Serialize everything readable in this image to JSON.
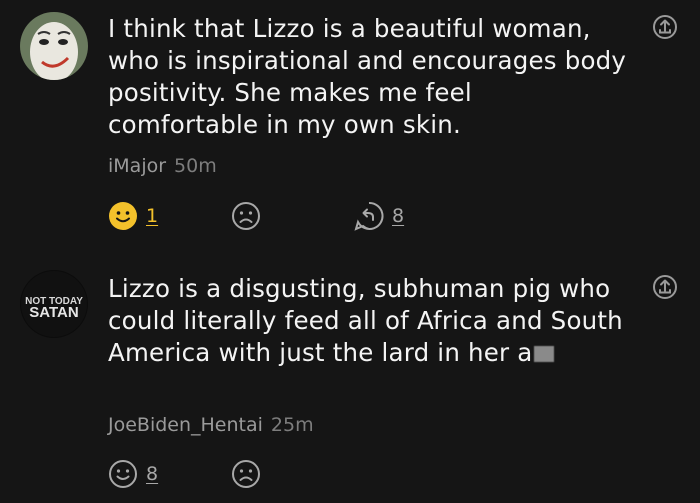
{
  "comments": [
    {
      "author": "iMajor",
      "time": "50m",
      "text": "I think that Lizzo is a beautiful woman, who is inspirational and encourages body positivity. She makes me feel comfortable in my own skin.",
      "like_count": "1",
      "reply_count": "8",
      "avatar_icon": "face-mask-avatar"
    },
    {
      "author": "JoeBiden_Hentai",
      "time": "25m",
      "text_visible": "Lizzo is a disgusting, subhuman pig who could literally feed all of Africa and South America with just the lard in her a",
      "like_count": "8",
      "avatar_icon": "not-today-satan-avatar",
      "avatar_logo_line1": "NOT TODAY",
      "avatar_logo_line2": "SATAN"
    }
  ],
  "colors": {
    "background": "#151515",
    "accent_gold": "#f3c12b",
    "icon_gray": "#a8a8a8"
  }
}
